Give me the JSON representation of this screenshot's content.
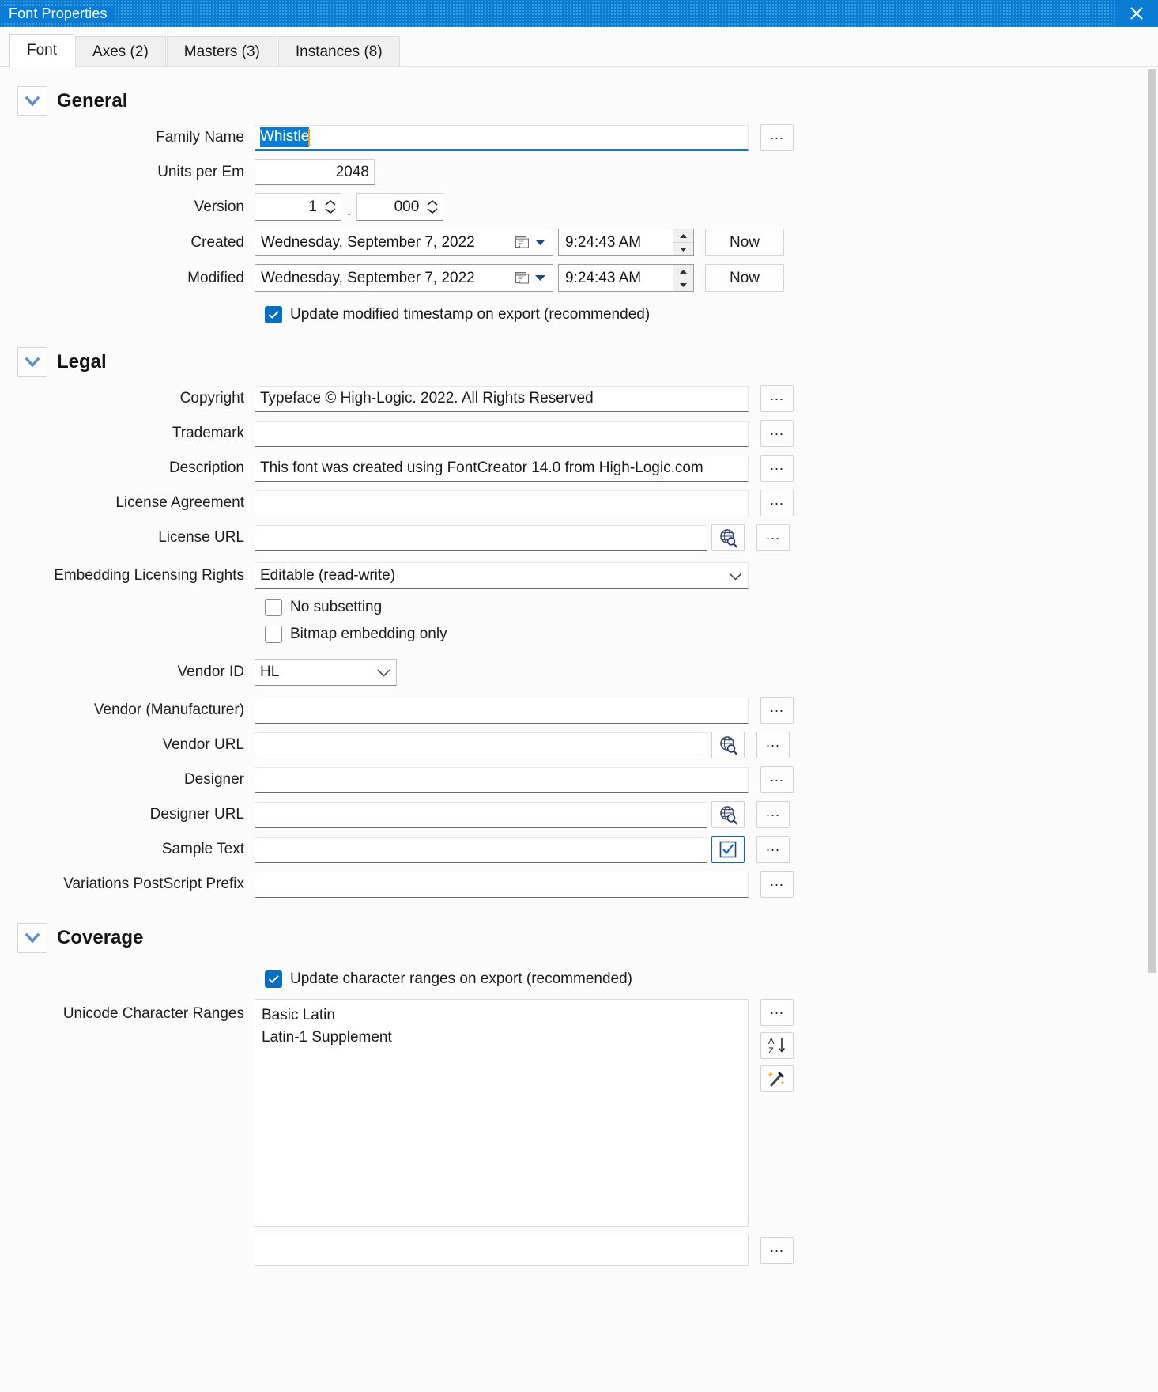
{
  "window": {
    "title": "Font Properties",
    "close_label": "close-icon"
  },
  "tabs": [
    {
      "label": "Font",
      "active": true
    },
    {
      "label": "Axes (2)",
      "active": false
    },
    {
      "label": "Masters (3)",
      "active": false
    },
    {
      "label": "Instances (8)",
      "active": false
    }
  ],
  "sections": {
    "general": {
      "title": "General",
      "family_name": {
        "label": "Family Name",
        "value": "Whistle",
        "selected": true
      },
      "units_per_em": {
        "label": "Units per Em",
        "value": "2048"
      },
      "version": {
        "label": "Version",
        "major": "1",
        "separator": ".",
        "minor": "000"
      },
      "created": {
        "label": "Created",
        "date": "Wednesday, September   7, 2022",
        "time": "9:24:43 AM",
        "now_label": "Now"
      },
      "modified": {
        "label": "Modified",
        "date": "Wednesday, September   7, 2022",
        "time": "9:24:43 AM",
        "now_label": "Now"
      },
      "update_timestamp": {
        "label": "Update modified timestamp on export (recommended)",
        "checked": true
      }
    },
    "legal": {
      "title": "Legal",
      "copyright": {
        "label": "Copyright",
        "value": "Typeface © High-Logic. 2022. All Rights Reserved"
      },
      "trademark": {
        "label": "Trademark",
        "value": ""
      },
      "description": {
        "label": "Description",
        "value": "This font was created using FontCreator 14.0 from High-Logic.com"
      },
      "license_agreement": {
        "label": "License Agreement",
        "value": ""
      },
      "license_url": {
        "label": "License URL",
        "value": ""
      },
      "embedding_rights": {
        "label": "Embedding Licensing Rights",
        "value": "Editable (read-write)",
        "options": [
          "Editable (read-write)"
        ]
      },
      "no_subsetting": {
        "label": "No subsetting",
        "checked": false
      },
      "bitmap_embedding_only": {
        "label": "Bitmap embedding only",
        "checked": false
      },
      "vendor_id": {
        "label": "Vendor ID",
        "value": "HL",
        "options": [
          "HL"
        ]
      },
      "vendor_manufacturer": {
        "label": "Vendor (Manufacturer)",
        "value": ""
      },
      "vendor_url": {
        "label": "Vendor URL",
        "value": ""
      },
      "designer": {
        "label": "Designer",
        "value": ""
      },
      "designer_url": {
        "label": "Designer URL",
        "value": ""
      },
      "sample_text": {
        "label": "Sample Text",
        "value": ""
      },
      "variations_ps_prefix": {
        "label": "Variations PostScript Prefix",
        "value": ""
      }
    },
    "coverage": {
      "title": "Coverage",
      "update_ranges": {
        "label": "Update character ranges on export (recommended)",
        "checked": true
      },
      "unicode_ranges": {
        "label": "Unicode Character Ranges",
        "items": [
          "Basic Latin",
          "Latin-1 Supplement"
        ]
      }
    }
  },
  "buttons": {
    "ellipsis": "...",
    "sort_icon": "sort-az-icon",
    "wand_icon": "magic-wand-icon",
    "globe_icon": "globe-search-icon",
    "check_icon": "check-box-icon"
  },
  "colors": {
    "accent": "#0a7cd4",
    "title_bar": "#0a7cd4",
    "selection": "#0a7cd4",
    "checkbox_on": "#0a6ec0",
    "chevron": "#5b8fc9"
  }
}
